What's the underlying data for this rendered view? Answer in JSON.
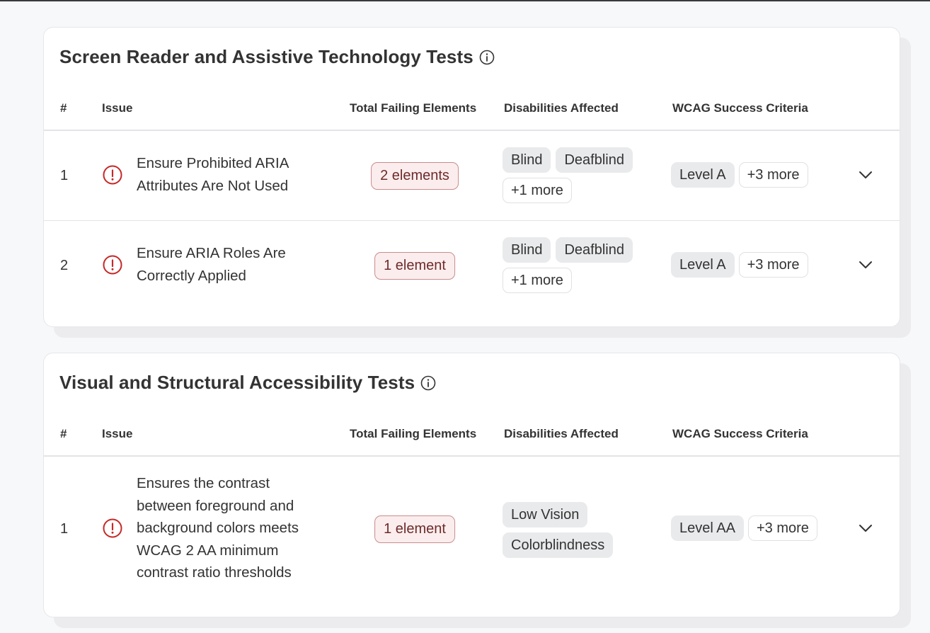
{
  "sections": [
    {
      "title": "Screen Reader and Assistive Technology Tests",
      "columns": [
        "#",
        "Issue",
        "Total Failing Elements",
        "Disabilities Affected",
        "WCAG Success Criteria"
      ],
      "rows": [
        {
          "num": "1",
          "issue": "Ensure Prohibited ARIA Attributes Are Not Used",
          "count": "2 elements",
          "disabilities": [
            "Blind",
            "Deafblind"
          ],
          "disabilities_more": "+1 more",
          "wcag_level": "Level A",
          "wcag_more": "+3 more"
        },
        {
          "num": "2",
          "issue": "Ensure ARIA Roles Are Correctly Applied",
          "count": "1 element",
          "disabilities": [
            "Blind",
            "Deafblind"
          ],
          "disabilities_more": "+1 more",
          "wcag_level": "Level A",
          "wcag_more": "+3 more"
        }
      ]
    },
    {
      "title": "Visual and Structural Accessibility Tests",
      "columns": [
        "#",
        "Issue",
        "Total Failing Elements",
        "Disabilities Affected",
        "WCAG Success Criteria"
      ],
      "rows": [
        {
          "num": "1",
          "issue": "Ensures the contrast between foreground and background colors meets WCAG 2 AA minimum contrast ratio thresholds",
          "count": "1 element",
          "disabilities": [
            "Low Vision",
            "Colorblindness"
          ],
          "disabilities_more": "",
          "wcag_level": "Level AA",
          "wcag_more": "+3 more"
        }
      ]
    }
  ],
  "icons": {
    "info": "info-icon",
    "alert": "alert-circle-icon",
    "expand": "chevron-down-icon"
  },
  "colors": {
    "alert": "#c62828",
    "badge_bg": "#fbeded",
    "badge_border": "#c98c8c",
    "tag_bg": "#e9eaec"
  }
}
